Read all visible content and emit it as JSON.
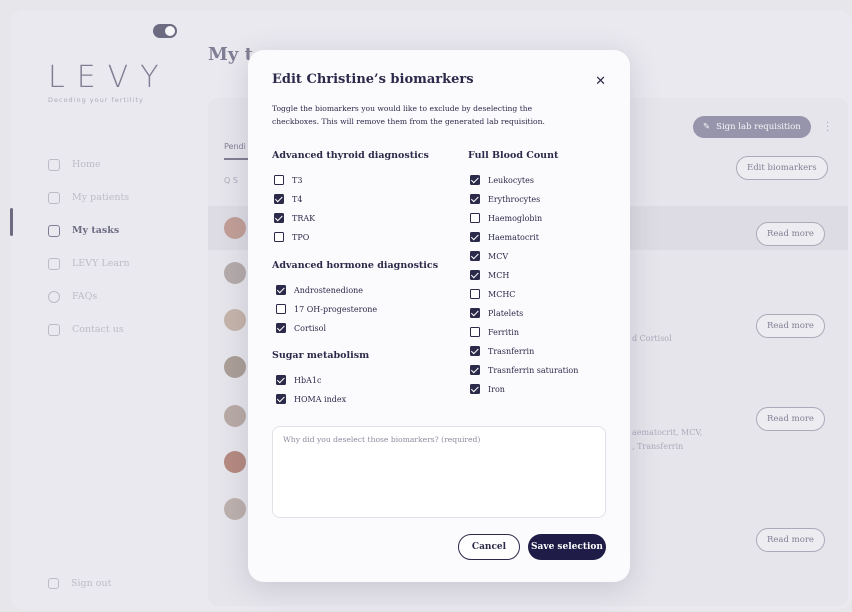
{
  "sidebar": {
    "logo": "LEVY",
    "tagline": "Decoding your fertility",
    "items": [
      {
        "label": "Home",
        "icon": "home-icon"
      },
      {
        "label": "My patients",
        "icon": "patients-icon"
      },
      {
        "label": "My tasks",
        "icon": "tasks-icon"
      },
      {
        "label": "LEVY Learn",
        "icon": "learn-icon"
      },
      {
        "label": "FAQs",
        "icon": "faq-icon"
      },
      {
        "label": "Contact us",
        "icon": "contact-icon"
      }
    ],
    "sign_out": "Sign out"
  },
  "main": {
    "title": "My t",
    "tab_label": "Pendi",
    "search_stub": "Q  S",
    "sign_lab_label": "Sign lab requisition",
    "edit_biomarkers_label": "Edit biomarkers",
    "read_more_label": "Read more",
    "bg_text_1": "d Cortisol",
    "bg_text_2": "aematocrit, MCV,",
    "bg_text_3": ", Transferrin"
  },
  "modal": {
    "title": "Edit Christine’s biomarkers",
    "description": "Toggle the biomarkers you would like to exclude by deselecting the checkboxes. This will remove them from the generated lab requisition.",
    "groups": {
      "thyroid": {
        "title": "Advanced thyroid diagnostics",
        "items": [
          {
            "label": "T3",
            "checked": false
          },
          {
            "label": "T4",
            "checked": true
          },
          {
            "label": "TRAK",
            "checked": true
          },
          {
            "label": "TPO",
            "checked": false
          }
        ]
      },
      "hormone": {
        "title": "Advanced hormone diagnostics",
        "items": [
          {
            "label": "Androstenedione",
            "checked": true
          },
          {
            "label": "17 OH-progesterone",
            "checked": false
          },
          {
            "label": "Cortisol",
            "checked": true
          }
        ]
      },
      "sugar": {
        "title": "Sugar metabolism",
        "items": [
          {
            "label": "HbA1c",
            "checked": true
          },
          {
            "label": "HOMA index",
            "checked": true
          }
        ]
      },
      "blood": {
        "title": "Full Blood Count",
        "items": [
          {
            "label": "Leukocytes",
            "checked": true
          },
          {
            "label": "Erythrocytes",
            "checked": true
          },
          {
            "label": "Haemoglobin",
            "checked": false
          },
          {
            "label": "Haematocrit",
            "checked": true
          },
          {
            "label": "MCV",
            "checked": true
          },
          {
            "label": "MCH",
            "checked": true
          },
          {
            "label": "MCHC",
            "checked": false
          },
          {
            "label": "Platelets",
            "checked": true
          },
          {
            "label": "Ferritin",
            "checked": false
          },
          {
            "label": "Trasnferrin",
            "checked": true
          },
          {
            "label": "Trasnferrin saturation",
            "checked": true
          },
          {
            "label": "Iron",
            "checked": true
          }
        ]
      }
    },
    "reason_placeholder": "Why did you deselect those biomarkers? (required)",
    "cancel_label": "Cancel",
    "save_label": "Save selection"
  },
  "colors": {
    "primary": "#1f1c47",
    "accent": "#6d6a8a",
    "background": "#edecf1"
  }
}
